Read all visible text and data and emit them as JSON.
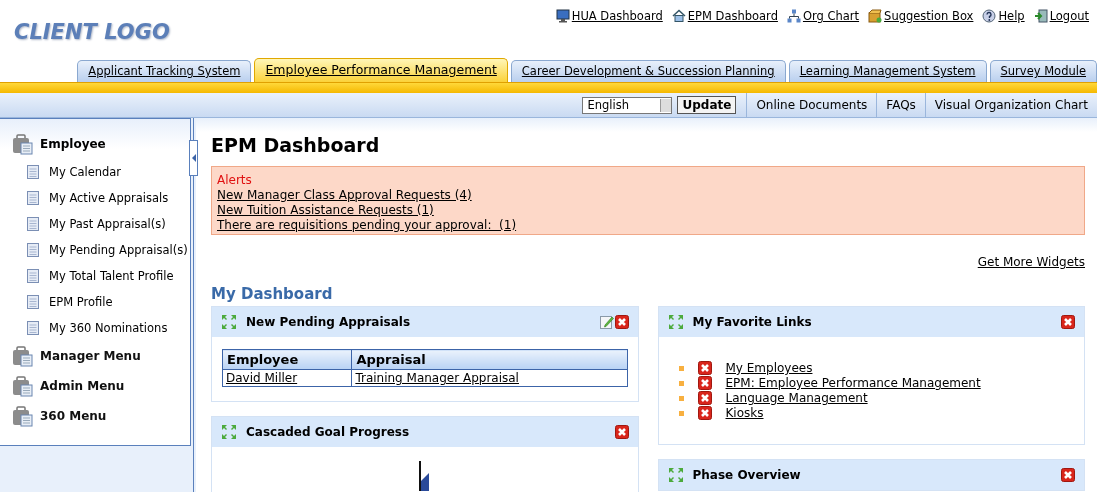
{
  "logo": "CLIENT LOGO",
  "top_links": [
    {
      "label": "HUA Dashboard",
      "kind": "monitor"
    },
    {
      "label": "EPM Dashboard",
      "kind": "home"
    },
    {
      "label": "Org Chart",
      "kind": "org"
    },
    {
      "label": "Suggestion Box",
      "kind": "box"
    },
    {
      "label": "Help",
      "kind": "help"
    },
    {
      "label": "Logout",
      "kind": "logout"
    }
  ],
  "tabs": [
    {
      "label": "Applicant Tracking System",
      "selected": false
    },
    {
      "label": "Employee Performance Management",
      "selected": true
    },
    {
      "label": "Career Development & Succession Planning",
      "selected": false
    },
    {
      "label": "Learning Management System",
      "selected": false
    },
    {
      "label": "Survey Module",
      "selected": false
    }
  ],
  "language": {
    "value": "English",
    "button": "Update"
  },
  "sub_links": [
    "Online Documents",
    "FAQs",
    "Visual Organization Chart"
  ],
  "sidebar": {
    "items": [
      {
        "label": "Employee",
        "expanded": true,
        "children": [
          {
            "label": "My Calendar"
          },
          {
            "label": "My Active Appraisals"
          },
          {
            "label": "My Past Appraisal(s)"
          },
          {
            "label": "My Pending Appraisal(s)"
          },
          {
            "label": "My Total Talent Profile"
          },
          {
            "label": "EPM Profile"
          },
          {
            "label": "My 360 Nominations"
          }
        ]
      },
      {
        "label": "Manager Menu",
        "expanded": false
      },
      {
        "label": "Admin Menu",
        "expanded": false
      },
      {
        "label": "360 Menu",
        "expanded": false
      }
    ]
  },
  "page_title": "EPM Dashboard",
  "alerts": {
    "title": "Alerts",
    "links": [
      "New Manager Class Approval Requests (4)",
      "New Tuition Assistance Requests (1)",
      "There are requisitions pending your approval:  (1)"
    ]
  },
  "get_more_widgets": "Get More Widgets",
  "dashboard_title": "My Dashboard",
  "columns": [
    [
      {
        "title": "New Pending Appraisals",
        "editable": true,
        "kind": "table",
        "table": {
          "columns": [
            "Employee",
            "Appraisal"
          ],
          "rows": [
            [
              "David Miller",
              "Training Manager Appraisal"
            ]
          ]
        }
      },
      {
        "title": "Cascaded Goal Progress",
        "editable": false,
        "kind": "chart"
      }
    ],
    [
      {
        "title": "My Favorite Links",
        "editable": false,
        "kind": "links",
        "links": [
          "My Employees",
          "EPM: Employee Performance Management",
          "Language Management",
          "Kiosks"
        ]
      },
      {
        "title": "Phase Overview",
        "editable": false,
        "kind": "empty"
      }
    ]
  ]
}
